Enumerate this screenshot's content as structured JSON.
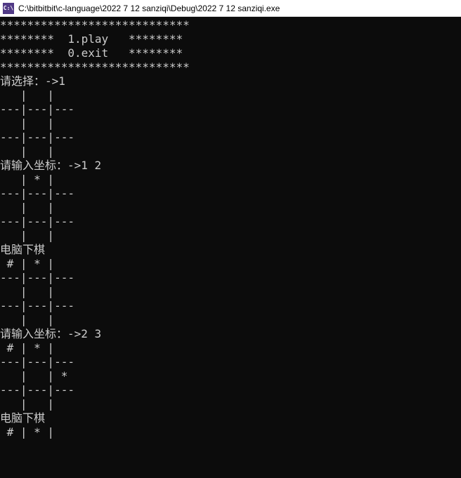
{
  "window": {
    "icon_text": "C:\\",
    "title": "C:\\bitbitbit\\c-language\\2022 7 12 sanziqi\\Debug\\2022 7 12 sanziqi.exe"
  },
  "console_lines": [
    "****************************",
    "********  1.play   ********",
    "********  0.exit   ********",
    "****************************",
    "请选择：->1",
    "   |   |   ",
    "---|---|---",
    "   |   |   ",
    "---|---|---",
    "   |   |   ",
    "",
    "请输入坐标：->1 2",
    "   | * |   ",
    "---|---|---",
    "   |   |   ",
    "---|---|---",
    "   |   |   ",
    "",
    "电脑下棋",
    " # | * |   ",
    "---|---|---",
    "   |   |   ",
    "---|---|---",
    "   |   |   ",
    "",
    "请输入坐标：->2 3",
    " # | * |   ",
    "---|---|---",
    "   |   | * ",
    "---|---|---",
    "   |   |   ",
    "",
    "电脑下棋",
    " # | * |   "
  ]
}
